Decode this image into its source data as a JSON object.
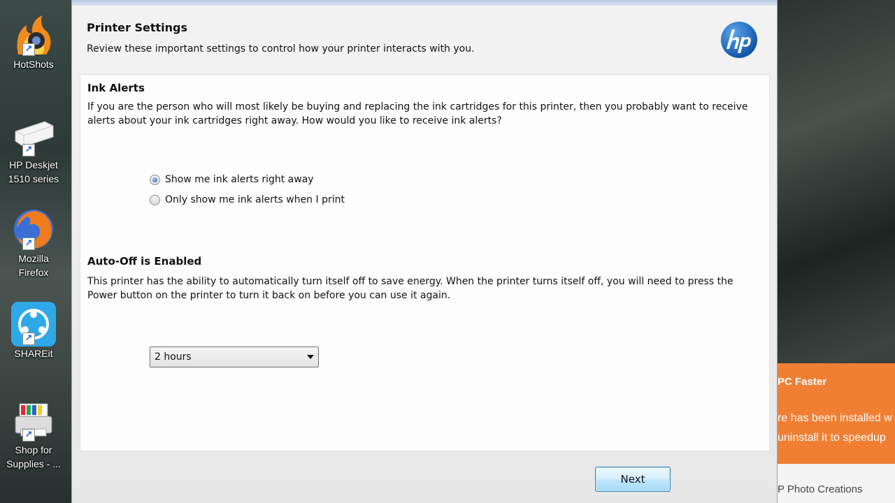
{
  "desktop": {
    "icons": [
      {
        "label_line1": "HotShots",
        "label_line2": ""
      },
      {
        "label_line1": "HP Deskjet",
        "label_line2": "1510 series"
      },
      {
        "label_line1": "Mozilla",
        "label_line2": "Firefox"
      },
      {
        "label_line1": "SHAREit",
        "label_line2": ""
      },
      {
        "label_line1": "Shop for",
        "label_line2": "Supplies - ..."
      }
    ]
  },
  "dialog": {
    "header": {
      "title": "Printer Settings",
      "subtitle": "Review these important settings to control how your printer interacts with you."
    },
    "ink_alerts": {
      "title": "Ink Alerts",
      "description": "If you are the person who will most likely be buying and replacing the ink cartridges for this printer, then you probably want to receive alerts about your ink cartridges right away. How would you like to receive ink alerts?",
      "options": [
        {
          "label": "Show me ink alerts right away",
          "selected": true
        },
        {
          "label": "Only show me ink alerts when I print",
          "selected": false
        }
      ]
    },
    "auto_off": {
      "title": "Auto-Off is Enabled",
      "description": "This printer has the ability to automatically turn itself off to save energy. When the printer turns itself off, you will need to press the Power button on the printer to turn it back on before you can use it again.",
      "selected_value": "2 hours"
    },
    "next_label": "Next"
  },
  "notification": {
    "title": "PC Faster",
    "line1": "re has been installed w",
    "line2": "uninstall it to speedup",
    "footer": "P Photo Creations"
  },
  "colors": {
    "notification_bg": "#f07f34",
    "hp_blue": "#1565c0",
    "button_border": "#3c7fb1"
  }
}
